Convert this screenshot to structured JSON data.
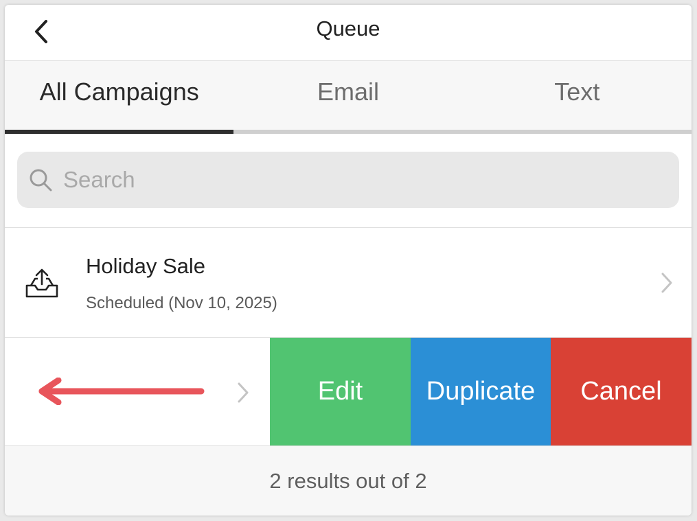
{
  "header": {
    "title": "Queue",
    "back_icon": "chevron-left-icon"
  },
  "tabs": [
    {
      "label": "All Campaigns",
      "active": true
    },
    {
      "label": "Email",
      "active": false
    },
    {
      "label": "Text",
      "active": false
    }
  ],
  "search": {
    "placeholder": "Search",
    "value": ""
  },
  "list": [
    {
      "icon": "outbox-upload-icon",
      "title": "Holiday Sale",
      "status": "Scheduled (Nov 10, 2025)"
    }
  ],
  "swipe_actions": {
    "edit_label": "Edit",
    "duplicate_label": "Duplicate",
    "cancel_label": "Cancel"
  },
  "footer": {
    "results_text": "2 results out of 2"
  },
  "colors": {
    "edit": "#51c471",
    "duplicate": "#2b8fd6",
    "cancel": "#d94135",
    "swipe_arrow": "#e8555b",
    "active_tab_indicator": "#2e2e2e"
  }
}
